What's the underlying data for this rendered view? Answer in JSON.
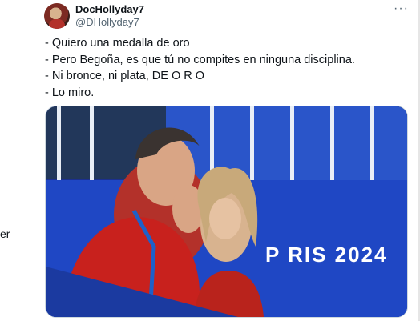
{
  "sidebar": {
    "edge_text": "er"
  },
  "tweet": {
    "display_name": "DocHollyday7",
    "handle": "@DHollyday7",
    "more_icon": "more-horizontal-icon",
    "lines": [
      "- Quiero una medalla de oro",
      "- Pero Begoña, es que tú no compites en ninguna disciplina.",
      "- Ni bronce, ni plata, DE O R O",
      "- Lo miro."
    ],
    "media": {
      "banner_text": "P   RIS 2024"
    }
  },
  "colors": {
    "accent_blue": "#1d3cae",
    "shirt_red": "#c8211d",
    "text_secondary": "#536471"
  }
}
